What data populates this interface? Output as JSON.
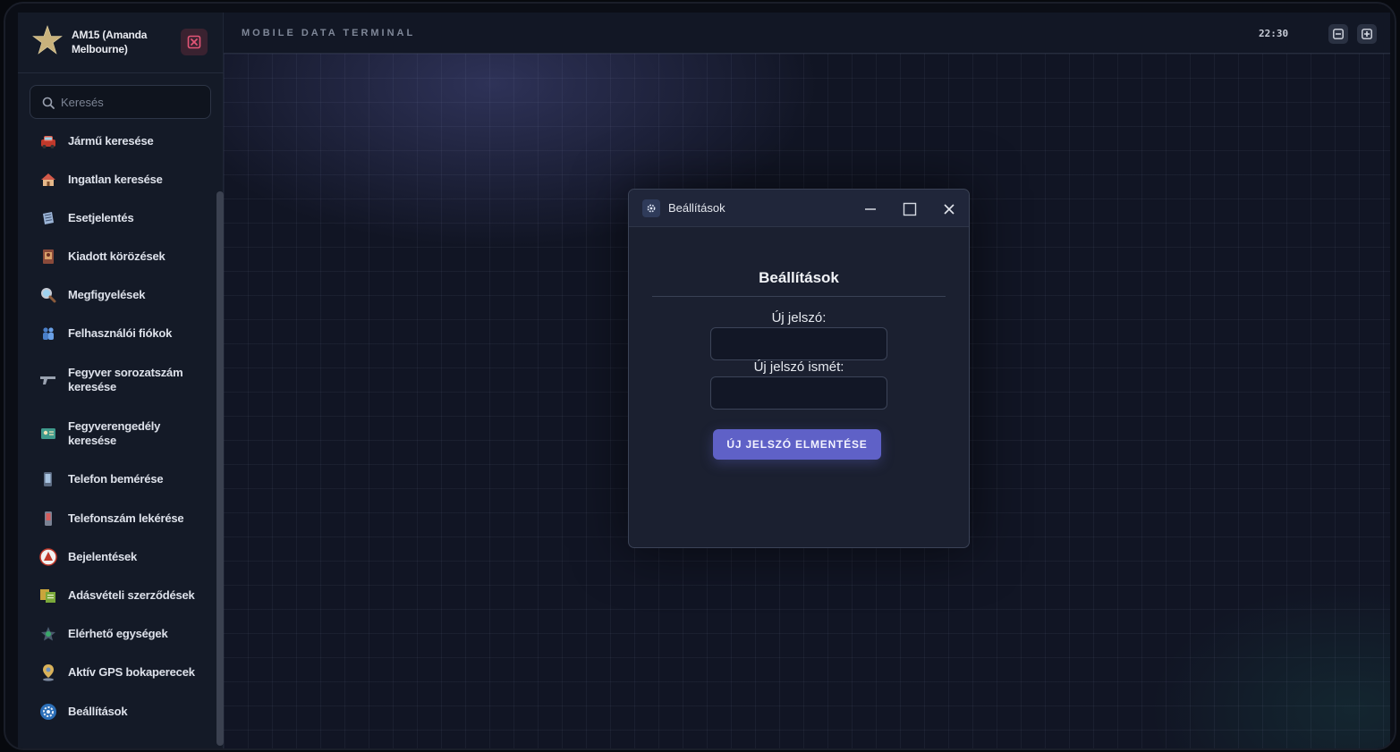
{
  "user": {
    "name": "AM15 (Amanda Melbourne)"
  },
  "search": {
    "placeholder": "Keresés"
  },
  "sidebar": {
    "items": [
      {
        "label": "Jármű keresése",
        "icon": "car-icon"
      },
      {
        "label": "Ingatlan keresése",
        "icon": "house-icon"
      },
      {
        "label": "Esetjelentés",
        "icon": "report-icon"
      },
      {
        "label": "Kiadott körözések",
        "icon": "warrant-icon"
      },
      {
        "label": "Megfigyelések",
        "icon": "magnifier-icon"
      },
      {
        "label": "Felhasználói fiókok",
        "icon": "users-icon"
      },
      {
        "label": "Fegyver sorozatszám keresése",
        "icon": "gun-icon"
      },
      {
        "label": "Fegyverengedély keresése",
        "icon": "license-icon"
      },
      {
        "label": "Telefon bemérése",
        "icon": "phone-track-icon"
      },
      {
        "label": "Telefonszám lekérése",
        "icon": "phone-icon"
      },
      {
        "label": "Bejelentések",
        "icon": "alert-icon"
      },
      {
        "label": "Adásvételi szerződések",
        "icon": "contract-icon"
      },
      {
        "label": "Elérhető egységek",
        "icon": "units-icon"
      },
      {
        "label": "Aktív GPS bokaperecek",
        "icon": "gps-icon"
      },
      {
        "label": "Beállítások",
        "icon": "gear-icon"
      }
    ]
  },
  "topbar": {
    "title": "MOBILE DATA TERMINAL",
    "time": "22:30"
  },
  "window": {
    "title": "Beállítások",
    "heading": "Beállítások",
    "new_password_label": "Új jelszó:",
    "new_password_value": "",
    "confirm_password_label": "Új jelszó ismét:",
    "confirm_password_value": "",
    "save_label": "ÚJ JELSZÓ ELMENTÉSE"
  },
  "colors": {
    "accent": "#5f61c7",
    "background": "#111524",
    "sidebar": "#141a27",
    "danger": "#d24a6a"
  }
}
